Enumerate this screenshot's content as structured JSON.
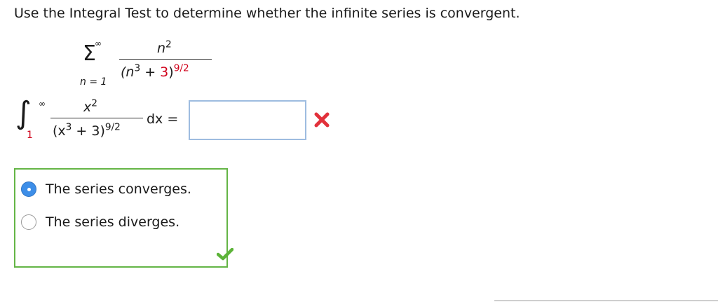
{
  "question": {
    "text": "Use the Integral Test to determine whether the infinite series is convergent."
  },
  "series": {
    "sum_upper": "∞",
    "sum_lower": "n = 1",
    "numerator_base": "n",
    "numerator_exp": "2",
    "den_open": "(n",
    "den_inner_exp": "3",
    "den_plus": " + ",
    "den_const": "3",
    "den_close": ")",
    "den_outer_exp": "9/2"
  },
  "integral": {
    "upper": "∞",
    "lower": "1",
    "numerator_base": "x",
    "numerator_exp": "2",
    "den_open": "(x",
    "den_inner_exp": "3",
    "den_plus": " + 3)",
    "den_outer_exp": "9/2",
    "dx": "dx =",
    "answer_value": "",
    "answer_status_icon": "incorrect-x-icon"
  },
  "choices": {
    "options": [
      {
        "label": "The series converges.",
        "selected": true
      },
      {
        "label": "The series diverges.",
        "selected": false
      }
    ],
    "status_icon": "correct-check-icon",
    "border_color": "#64b546"
  },
  "colors": {
    "incorrect": "#d0021b",
    "correct": "#5cb338",
    "radio_selected": "#3d8ee8",
    "input_border": "#9ebce0"
  }
}
